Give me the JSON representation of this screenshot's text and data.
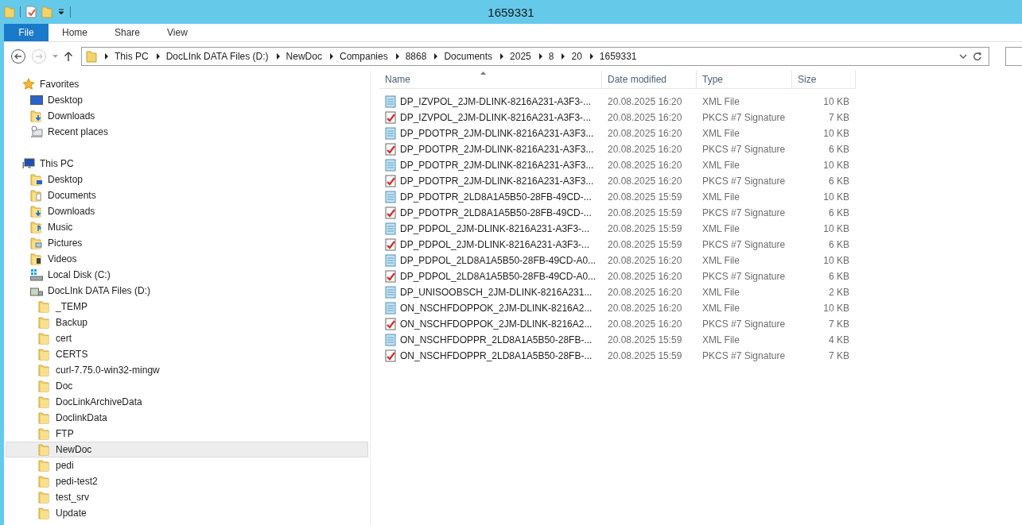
{
  "window": {
    "title": "1659331"
  },
  "ribbon_tabs": [
    {
      "label": "File",
      "selected": true
    },
    {
      "label": "Home",
      "selected": false
    },
    {
      "label": "Share",
      "selected": false
    },
    {
      "label": "View",
      "selected": false
    }
  ],
  "breadcrumb": [
    "This PC",
    "DocLInk DATA Files (D:)",
    "NewDoc",
    "Companies",
    "8868",
    "Documents",
    "2025",
    "8",
    "20",
    "1659331"
  ],
  "sidebar": {
    "groups": [
      {
        "label": "Favorites",
        "kind": "star",
        "selected": false,
        "children": [
          {
            "label": "Desktop",
            "kind": "desktop",
            "selected": false
          },
          {
            "label": "Downloads",
            "kind": "downloads",
            "selected": false
          },
          {
            "label": "Recent places",
            "kind": "recent",
            "selected": false
          }
        ]
      },
      {
        "label": "This PC",
        "kind": "pc",
        "selected": false,
        "children": [
          {
            "label": "Desktop",
            "kind": "folder-desktop",
            "selected": false
          },
          {
            "label": "Documents",
            "kind": "documents",
            "selected": false
          },
          {
            "label": "Downloads",
            "kind": "downloads",
            "selected": false
          },
          {
            "label": "Music",
            "kind": "music",
            "selected": false
          },
          {
            "label": "Pictures",
            "kind": "pictures",
            "selected": false
          },
          {
            "label": "Videos",
            "kind": "videos",
            "selected": false
          },
          {
            "label": "Local Disk (C:)",
            "kind": "drive-c",
            "selected": false
          },
          {
            "label": "DocLInk DATA Files (D:)",
            "kind": "drive-d",
            "selected": false,
            "children": [
              {
                "label": "_TEMP",
                "kind": "folder",
                "selected": false
              },
              {
                "label": "Backup",
                "kind": "folder",
                "selected": false
              },
              {
                "label": "cert",
                "kind": "folder",
                "selected": false
              },
              {
                "label": "CERTS",
                "kind": "folder",
                "selected": false
              },
              {
                "label": "curl-7.75.0-win32-mingw",
                "kind": "folder",
                "selected": false
              },
              {
                "label": "Doc",
                "kind": "folder",
                "selected": false
              },
              {
                "label": "DocLinkArchiveData",
                "kind": "folder",
                "selected": false
              },
              {
                "label": "DoclinkData",
                "kind": "folder",
                "selected": false
              },
              {
                "label": "FTP",
                "kind": "folder",
                "selected": false
              },
              {
                "label": "NewDoc",
                "kind": "folder",
                "selected": true
              },
              {
                "label": "pedi",
                "kind": "folder",
                "selected": false
              },
              {
                "label": "pedi-test2",
                "kind": "folder",
                "selected": false
              },
              {
                "label": "test_srv",
                "kind": "folder",
                "selected": false
              },
              {
                "label": "Update",
                "kind": "folder",
                "selected": false
              }
            ]
          }
        ]
      }
    ]
  },
  "table": {
    "columns": [
      "Name",
      "Date modified",
      "Type",
      "Size"
    ],
    "rows": [
      {
        "name": "DP_IZVPOL_2JM-DLINK-8216A231-A3F3-...",
        "date": "20.08.2025 16:20",
        "type": "XML File",
        "size": "10 KB",
        "kind": "xml"
      },
      {
        "name": "DP_IZVPOL_2JM-DLINK-8216A231-A3F3-...",
        "date": "20.08.2025 16:20",
        "type": "PKCS #7 Signature",
        "size": "7 KB",
        "kind": "signature"
      },
      {
        "name": "DP_PDOTPR_2JM-DLINK-8216A231-A3F3...",
        "date": "20.08.2025 16:20",
        "type": "XML File",
        "size": "10 KB",
        "kind": "xml"
      },
      {
        "name": "DP_PDOTPR_2JM-DLINK-8216A231-A3F3...",
        "date": "20.08.2025 16:20",
        "type": "PKCS #7 Signature",
        "size": "6 KB",
        "kind": "signature"
      },
      {
        "name": "DP_PDOTPR_2JM-DLINK-8216A231-A3F3...",
        "date": "20.08.2025 16:20",
        "type": "XML File",
        "size": "10 KB",
        "kind": "xml"
      },
      {
        "name": "DP_PDOTPR_2JM-DLINK-8216A231-A3F3...",
        "date": "20.08.2025 16:20",
        "type": "PKCS #7 Signature",
        "size": "6 KB",
        "kind": "signature"
      },
      {
        "name": "DP_PDOTPR_2LD8A1A5B50-28FB-49CD-...",
        "date": "20.08.2025 15:59",
        "type": "XML File",
        "size": "10 KB",
        "kind": "xml"
      },
      {
        "name": "DP_PDOTPR_2LD8A1A5B50-28FB-49CD-...",
        "date": "20.08.2025 15:59",
        "type": "PKCS #7 Signature",
        "size": "6 KB",
        "kind": "signature"
      },
      {
        "name": "DP_PDPOL_2JM-DLINK-8216A231-A3F3-...",
        "date": "20.08.2025 15:59",
        "type": "XML File",
        "size": "10 KB",
        "kind": "xml"
      },
      {
        "name": "DP_PDPOL_2JM-DLINK-8216A231-A3F3-...",
        "date": "20.08.2025 15:59",
        "type": "PKCS #7 Signature",
        "size": "6 KB",
        "kind": "signature"
      },
      {
        "name": "DP_PDPOL_2LD8A1A5B50-28FB-49CD-A0...",
        "date": "20.08.2025 16:20",
        "type": "XML File",
        "size": "10 KB",
        "kind": "xml"
      },
      {
        "name": "DP_PDPOL_2LD8A1A5B50-28FB-49CD-A0...",
        "date": "20.08.2025 16:20",
        "type": "PKCS #7 Signature",
        "size": "6 KB",
        "kind": "signature"
      },
      {
        "name": "DP_UNISOOBSCH_2JM-DLINK-8216A231...",
        "date": "20.08.2025 16:20",
        "type": "XML File",
        "size": "2 KB",
        "kind": "xml"
      },
      {
        "name": "ON_NSCHFDOPPOK_2JM-DLINK-8216A2...",
        "date": "20.08.2025 16:20",
        "type": "XML File",
        "size": "10 KB",
        "kind": "xml"
      },
      {
        "name": "ON_NSCHFDOPPOK_2JM-DLINK-8216A2...",
        "date": "20.08.2025 16:20",
        "type": "PKCS #7 Signature",
        "size": "7 KB",
        "kind": "signature"
      },
      {
        "name": "ON_NSCHFDOPPR_2LD8A1A5B50-28FB-...",
        "date": "20.08.2025 15:59",
        "type": "XML File",
        "size": "4 KB",
        "kind": "xml"
      },
      {
        "name": "ON_NSCHFDOPPR_2LD8A1A5B50-28FB-...",
        "date": "20.08.2025 15:59",
        "type": "PKCS #7 Signature",
        "size": "7 KB",
        "kind": "signature"
      }
    ]
  }
}
